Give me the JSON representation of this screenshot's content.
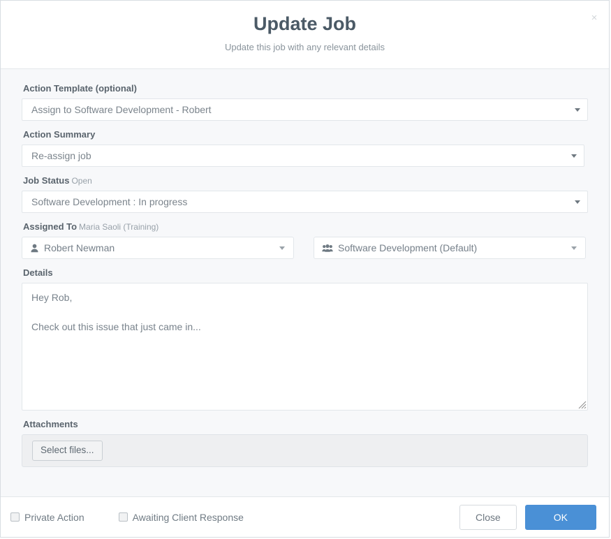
{
  "modal": {
    "title": "Update Job",
    "subtitle": "Update this job with any relevant details",
    "close_icon": "close-icon",
    "close_glyph": "×"
  },
  "form": {
    "action_template": {
      "label": "Action Template (optional)",
      "value": "Assign to Software Development - Robert"
    },
    "action_summary": {
      "label": "Action Summary",
      "value": "Re-assign job"
    },
    "job_status": {
      "label": "Job Status",
      "sub_label": "Open",
      "value": "Software Development : In progress"
    },
    "assigned_to": {
      "label": "Assigned To",
      "sub_label": "Maria Saoli (Training)",
      "user_value": "Robert Newman",
      "user_icon": "user-icon",
      "team_value": "Software Development (Default)",
      "team_icon": "users-group-icon"
    },
    "details": {
      "label": "Details",
      "value": "Hey Rob,\n\nCheck out this issue that just came in..."
    },
    "attachments": {
      "label": "Attachments",
      "select_files_label": "Select files..."
    }
  },
  "footer": {
    "private_action_label": "Private Action",
    "private_action_checked": false,
    "awaiting_client_label": "Awaiting Client Response",
    "awaiting_client_checked": false,
    "close_label": "Close",
    "ok_label": "OK"
  },
  "colors": {
    "primary": "#4a90d6",
    "body_bg": "#f7f8fa",
    "border": "#e2e6ea",
    "label_text": "#5a646d",
    "muted_text": "#98a1a9"
  }
}
